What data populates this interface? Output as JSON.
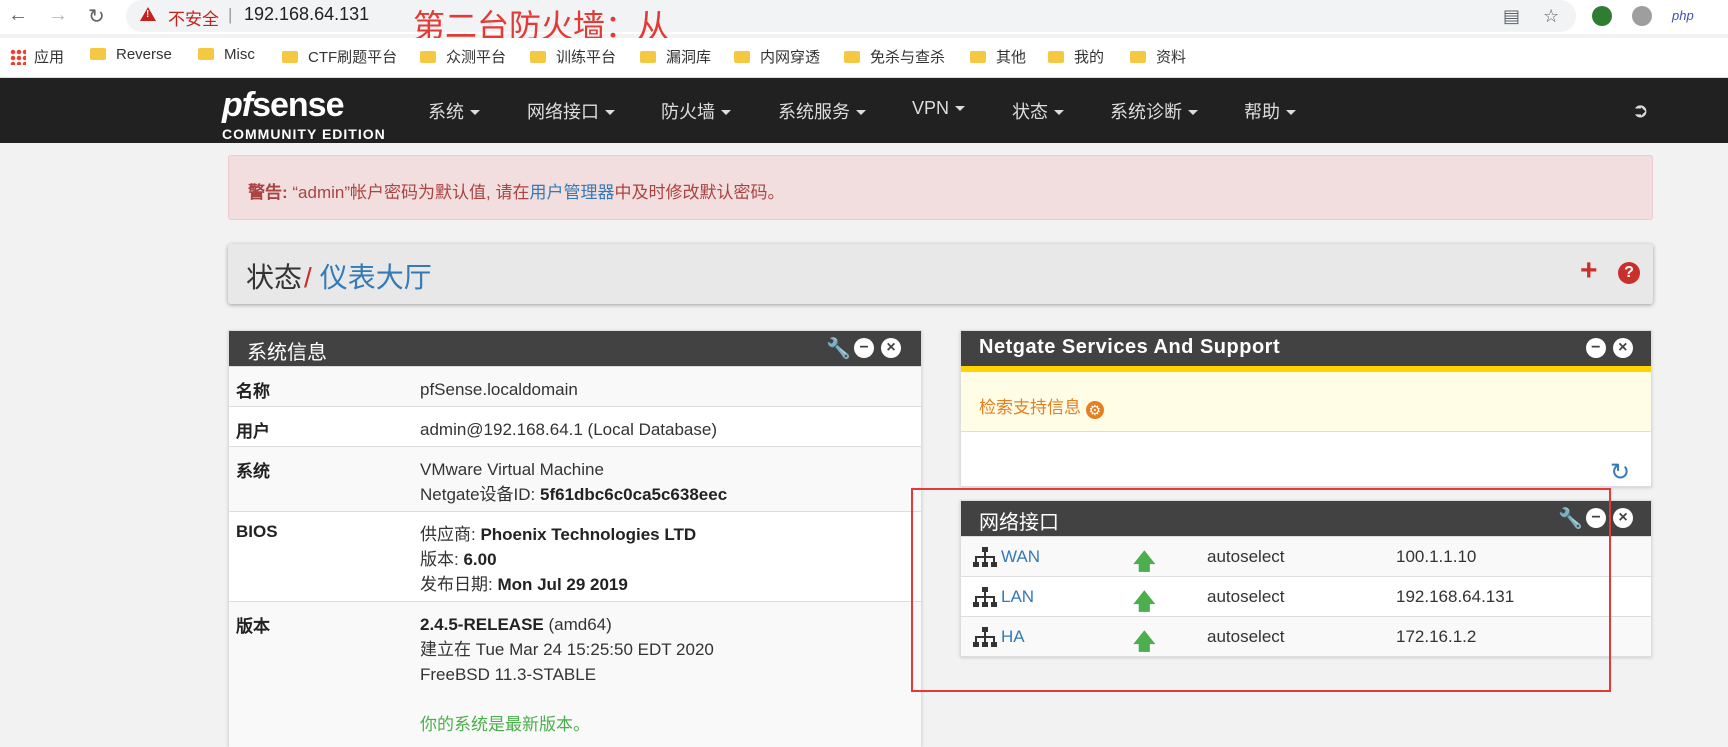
{
  "browser": {
    "insecure_label": "不安全",
    "separator": "|",
    "url": "192.168.64.131",
    "overlay_annotation": "第二台防火墙：从",
    "php_ext": "php"
  },
  "bookmarks": [
    {
      "label": "应用"
    },
    {
      "label": "Reverse"
    },
    {
      "label": "Misc"
    },
    {
      "label": "CTF刷题平台"
    },
    {
      "label": "众测平台"
    },
    {
      "label": "训练平台"
    },
    {
      "label": "漏洞库"
    },
    {
      "label": "内网穿透"
    },
    {
      "label": "免杀与查杀"
    },
    {
      "label": "其他"
    },
    {
      "label": "我的"
    },
    {
      "label": "资料"
    }
  ],
  "logo": {
    "pf": "pf",
    "sense": "sense",
    "edition": "COMMUNITY EDITION"
  },
  "menu": [
    {
      "label": "系统"
    },
    {
      "label": "网络接口"
    },
    {
      "label": "防火墙"
    },
    {
      "label": "系统服务"
    },
    {
      "label": "VPN"
    },
    {
      "label": "状态"
    },
    {
      "label": "系统诊断"
    },
    {
      "label": "帮助"
    }
  ],
  "alert": {
    "prefix": "警告:",
    "text1": " “admin”帐户密码为默认值, 请在",
    "link": "用户管理器",
    "text2": "中及时修改默认密码。"
  },
  "breadcrumb": {
    "section": "状态",
    "slash": "/",
    "page": "仪表大厅",
    "plus": "+",
    "help": "?"
  },
  "sysinfo": {
    "title": "系统信息",
    "name_k": "名称",
    "name_v": "pfSense.localdomain",
    "user_k": "用户",
    "user_v": "admin@192.168.64.1 (Local Database)",
    "system_k": "系统",
    "system_v1": "VMware Virtual Machine",
    "system_v2_label": "Netgate设备ID: ",
    "system_v2_val": "5f61dbc6c0ca5c638eec",
    "bios_k": "BIOS",
    "bios_vendor_label": "供应商: ",
    "bios_vendor": "Phoenix Technologies LTD",
    "bios_ver_label": "版本: ",
    "bios_ver": "6.00",
    "bios_date_label": "发布日期: ",
    "bios_date": "Mon Jul 29 2019",
    "version_k": "版本",
    "version_rel": "2.4.5-RELEASE",
    "version_arch": " (amd64)",
    "version_built": "建立在 Tue Mar 24 15:25:50 EDT 2020",
    "version_os": "FreeBSD 11.3-STABLE",
    "version_status": "你的系统是最新版本。"
  },
  "netgate": {
    "title": "Netgate Services And Support",
    "retrieve": "检索支持信息"
  },
  "interfaces": {
    "title": "网络接口",
    "rows": [
      {
        "name": "WAN",
        "media": "autoselect",
        "ip": "100.1.1.10"
      },
      {
        "name": "LAN",
        "media": "autoselect",
        "ip": "192.168.64.131"
      },
      {
        "name": "HA",
        "media": "autoselect",
        "ip": "172.16.1.2"
      }
    ]
  }
}
